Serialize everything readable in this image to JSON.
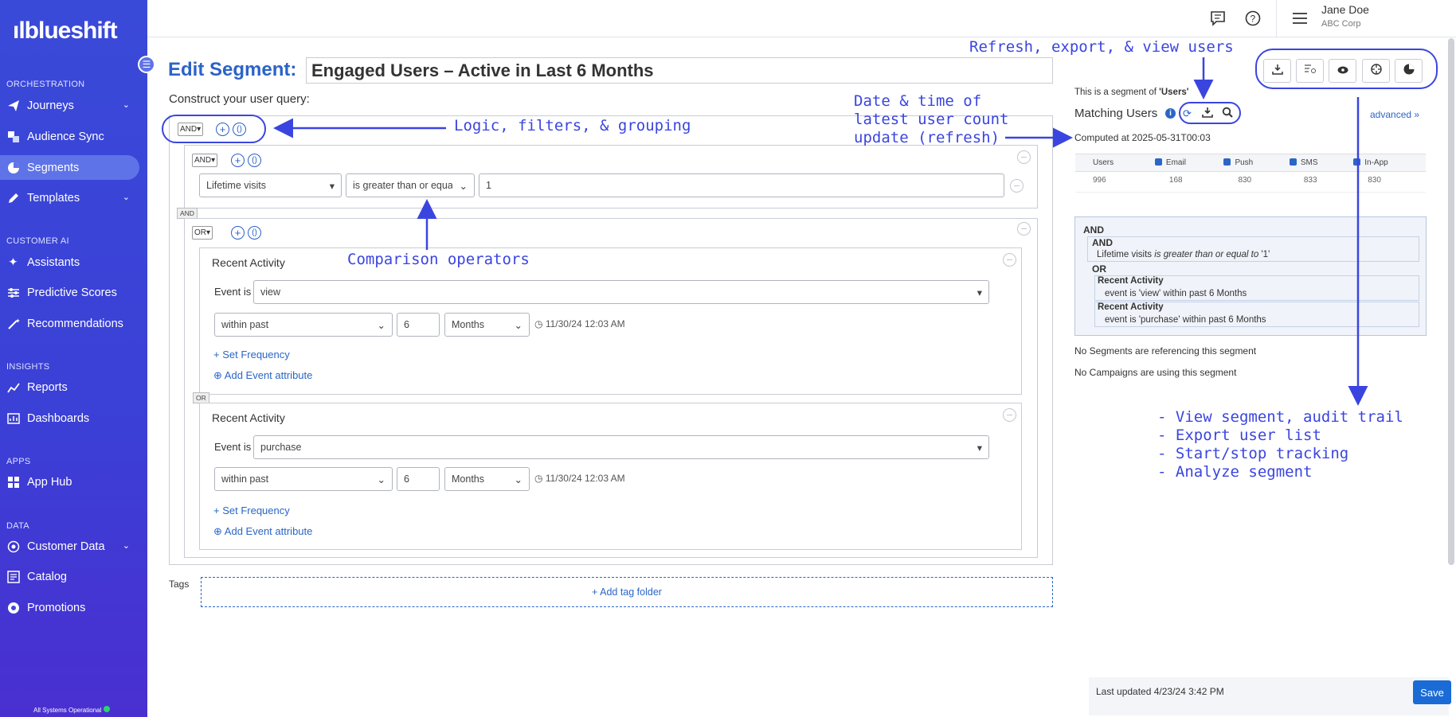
{
  "brand": {
    "logo": "ılblueshift"
  },
  "sidebar": {
    "sections": [
      "ORCHESTRATION",
      "CUSTOMER AI",
      "INSIGHTS",
      "APPS",
      "DATA"
    ],
    "items": [
      {
        "label": "Journeys",
        "icon": "send-icon"
      },
      {
        "label": "Audience Sync",
        "icon": "sync-icon"
      },
      {
        "label": "Segments",
        "icon": "segments-icon"
      },
      {
        "label": "Templates",
        "icon": "pencil-icon"
      },
      {
        "label": "Assistants",
        "icon": "sparkle-icon"
      },
      {
        "label": "Predictive Scores",
        "icon": "sliders-icon"
      },
      {
        "label": "Recommendations",
        "icon": "wand-icon"
      },
      {
        "label": "Reports",
        "icon": "chart-icon"
      },
      {
        "label": "Dashboards",
        "icon": "dashboard-icon"
      },
      {
        "label": "App Hub",
        "icon": "grid-icon"
      },
      {
        "label": "Customer Data",
        "icon": "database-icon"
      },
      {
        "label": "Catalog",
        "icon": "catalog-icon"
      },
      {
        "label": "Promotions",
        "icon": "promo-icon"
      }
    ],
    "status": "All Systems Operational"
  },
  "header": {
    "user": "Jane Doe",
    "company": "ABC Corp"
  },
  "page": {
    "title_label": "Edit Segment:",
    "segment_name": "Engaged Users – Active in Last 6 Months",
    "construct": "Construct your user query:",
    "root_logic": "AND",
    "group1_logic": "AND",
    "filter1": {
      "attribute": "Lifetime visits",
      "operator": "is greater than or equal to",
      "value": "1"
    },
    "join_and": "AND",
    "group2_logic": "OR",
    "activities": [
      {
        "title": "Recent Activity",
        "event_label": "Event is",
        "event": "view",
        "range": "within past",
        "num": "6",
        "unit": "Months",
        "time": "11/30/24 12:03 AM",
        "freq": "+ Set Frequency",
        "attr": "Add Event attribute"
      },
      {
        "title": "Recent Activity",
        "event_label": "Event is",
        "event": "purchase",
        "range": "within past",
        "num": "6",
        "unit": "Months",
        "time": "11/30/24 12:03 AM",
        "freq": "+ Set Frequency",
        "attr": "Add Event attribute"
      }
    ],
    "join_or": "OR",
    "tags_label": "Tags",
    "add_tag": "+ Add tag folder"
  },
  "right": {
    "segment_of_prefix": "This is a segment of ",
    "segment_of": "'Users'",
    "matching": "Matching Users",
    "advanced": "advanced »",
    "computed": "Computed at 2025-05-31T00:03",
    "columns": [
      "Users",
      "Email",
      "Push",
      "SMS",
      "In-App"
    ],
    "values": [
      "996",
      "168",
      "830",
      "833",
      "830"
    ],
    "tree": {
      "and1": "AND",
      "and2": "AND",
      "filter_attr": "Lifetime visits ",
      "filter_op": "is greater than or equal to",
      "filter_val": " '1'",
      "or": "OR",
      "ra1": "Recent Activity",
      "ev1": "event is 'view' within past 6 Months",
      "ra2": "Recent Activity",
      "ev2": "event is 'purchase' within past 6 Months"
    },
    "no_segments": "No Segments are referencing this segment",
    "no_campaigns": "No Campaigns are using this segment"
  },
  "annotations": {
    "refresh": "Refresh, export, & view users",
    "logic": "Logic, filters, & grouping",
    "date": "Date & time of\nlatest user count\nupdate (refresh)",
    "comparison": "Comparison operators",
    "actions": "- View segment, audit trail\n- Export user list\n- Start/stop tracking\n- Analyze segment"
  },
  "footer": {
    "updated": "Last updated 4/23/24 3:42 PM",
    "save": "Save"
  },
  "colors": {
    "sidebar": "#3b3fd6",
    "accent": "#2b63c8",
    "annotation": "#3a45e0"
  }
}
